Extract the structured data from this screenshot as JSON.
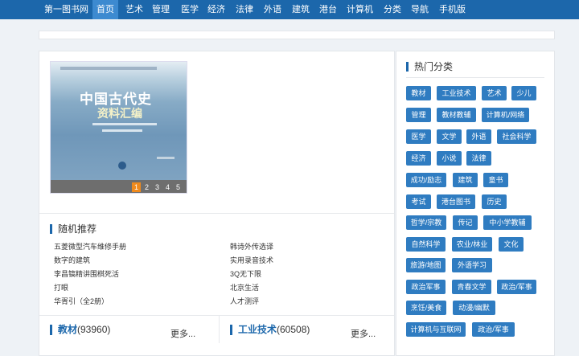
{
  "nav": {
    "items": [
      "第一图书网",
      "首页",
      "艺术",
      "管理",
      "医学",
      "经济",
      "法律",
      "外语",
      "建筑",
      "港台",
      "计算机",
      "分类",
      "导航",
      "手机版"
    ],
    "active": "首页"
  },
  "slider": {
    "cover_title": "中国古代史",
    "cover_subtitle": "资料汇编",
    "pages": [
      "1",
      "2",
      "3",
      "4",
      "5"
    ],
    "active_page": "1"
  },
  "random": {
    "title": "随机推荐",
    "left": [
      "五菱微型汽车维修手册",
      "数字的建筑",
      "李昌镐精讲围棋死活",
      "打眼",
      "华胥引（全2册）"
    ],
    "right": [
      "韩诗外传选译",
      "实用录音技术",
      "3Q无下限",
      "北京生活",
      "人才测评"
    ]
  },
  "categories": [
    {
      "name": "教材",
      "count": "(93960)",
      "more": "更多..."
    },
    {
      "name": "工业技术",
      "count": "(60508)",
      "more": "更多..."
    }
  ],
  "hot": {
    "title": "热门分类",
    "tags": [
      "教材",
      "工业技术",
      "艺术",
      "少儿",
      "管理",
      "教材教辅",
      "计算机/网络",
      "医学",
      "文学",
      "外语",
      "社会科学",
      "经济",
      "小说",
      "法律",
      "成功/励志",
      "建筑",
      "童书",
      "考试",
      "港台图书",
      "历史",
      "哲学/宗教",
      "传记",
      "中小学教辅",
      "自然科学",
      "农业/林业",
      "文化",
      "旅游/地图",
      "外语学习",
      "政治军事",
      "青春文学",
      "政治/军事",
      "烹饪/美食",
      "动漫/幽默",
      "计算机与互联网",
      "政治/军事"
    ]
  },
  "colors": {
    "nav_bg": "#1c67ab",
    "tag_bg": "#2f7cc1",
    "active_page": "#f08a1c"
  }
}
